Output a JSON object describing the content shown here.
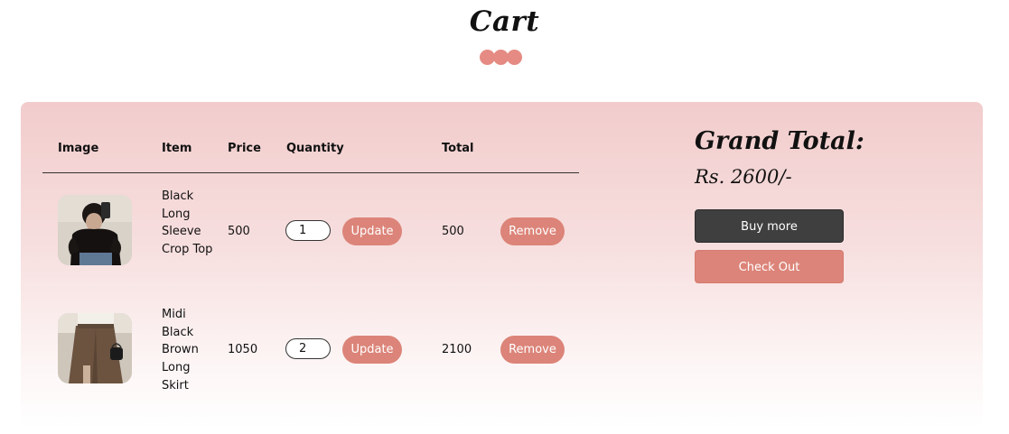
{
  "page": {
    "title": "Cart"
  },
  "colors": {
    "accent": "#dc8479",
    "dark_button": "#3f3f3f",
    "panel_top": "#f2cccc"
  },
  "table": {
    "headers": {
      "image": "Image",
      "item": "Item",
      "price": "Price",
      "quantity": "Quantity",
      "total": "Total"
    },
    "rows": [
      {
        "image_icon": "product-photo-black-crop-top",
        "name": "Black Long Sleeve Crop Top",
        "price": "500",
        "quantity": "1",
        "update_label": "Update",
        "total": "500",
        "remove_label": "Remove"
      },
      {
        "image_icon": "product-photo-brown-skirt",
        "name": "Midi Black Brown Long Skirt",
        "price": "1050",
        "quantity": "2",
        "update_label": "Update",
        "total": "2100",
        "remove_label": "Remove"
      }
    ]
  },
  "summary": {
    "grand_total_label": "Grand Total:",
    "grand_total_value": "Rs. 2600/-",
    "buy_more_label": "Buy more",
    "check_out_label": "Check Out"
  }
}
